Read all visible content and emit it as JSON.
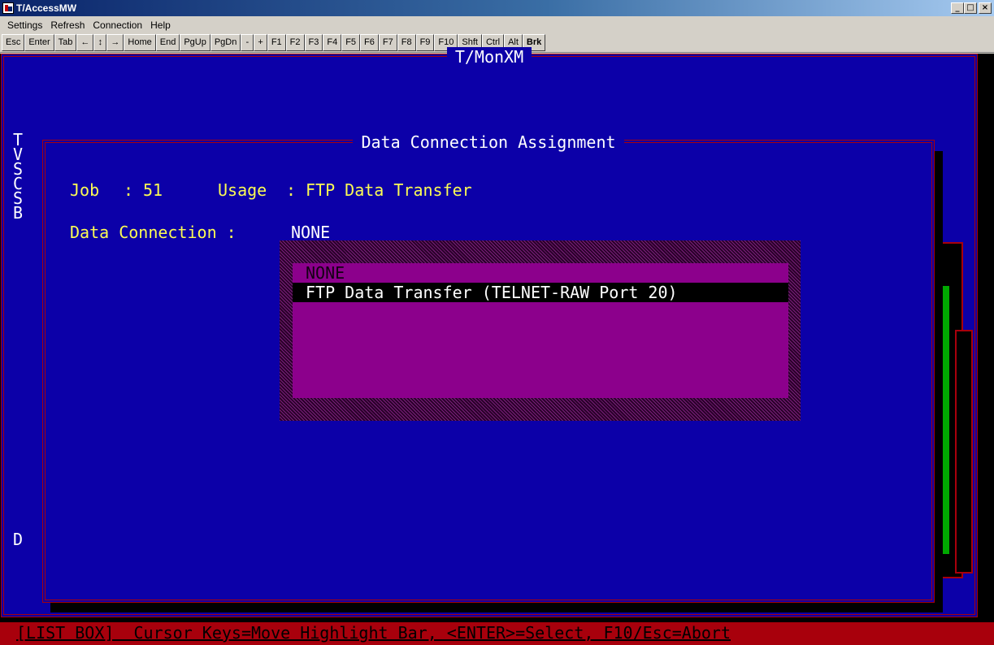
{
  "window": {
    "title": "T/AccessMW",
    "minimize_glyph": "_",
    "maximize_glyph": "□",
    "close_glyph": "×"
  },
  "menu": [
    {
      "label": "Settings"
    },
    {
      "label": "Refresh"
    },
    {
      "label": "Connection"
    },
    {
      "label": "Help"
    }
  ],
  "toolbar": [
    {
      "label": "Esc"
    },
    {
      "label": "Enter"
    },
    {
      "label": "Tab"
    },
    {
      "label": "←"
    },
    {
      "label": "↕"
    },
    {
      "label": "→"
    },
    {
      "label": "Home"
    },
    {
      "label": "End"
    },
    {
      "label": "PgUp"
    },
    {
      "label": "PgDn"
    },
    {
      "label": "-"
    },
    {
      "label": "+"
    },
    {
      "label": "F1"
    },
    {
      "label": "F2"
    },
    {
      "label": "F3"
    },
    {
      "label": "F4"
    },
    {
      "label": "F5"
    },
    {
      "label": "F6"
    },
    {
      "label": "F7"
    },
    {
      "label": "F8"
    },
    {
      "label": "F9"
    },
    {
      "label": "F10"
    },
    {
      "label": "Shft"
    },
    {
      "label": "Ctrl"
    },
    {
      "label": "Alt"
    },
    {
      "label": "Brk"
    }
  ],
  "terminal": {
    "screen_title": "T/MonXM",
    "background_letters": [
      "T",
      "V",
      "S",
      "C",
      "S",
      "B",
      "D"
    ],
    "dialog": {
      "title": "Data Connection Assignment",
      "job_label": "Job",
      "job_separator": ":",
      "job_value": "51",
      "usage_label": "Usage",
      "usage_separator": ":",
      "usage_value": "FTP Data Transfer",
      "data_connection_label": "Data Connection :",
      "data_connection_value": "NONE"
    },
    "listbox": {
      "items": [
        {
          "label": "NONE"
        },
        {
          "label": "FTP Data Transfer (TELNET-RAW Port 20)"
        }
      ]
    },
    "status": "[LIST BOX]  Cursor Keys=Move Highlight Bar, <ENTER>=Select, F10/Esc=Abort"
  },
  "colors": {
    "terminal_blue": "#0c00a8",
    "frame_red": "#a8000c",
    "label_yellow": "#fcfc54",
    "listbox_magenta": "#8c008c",
    "panel_green": "#00a800"
  }
}
